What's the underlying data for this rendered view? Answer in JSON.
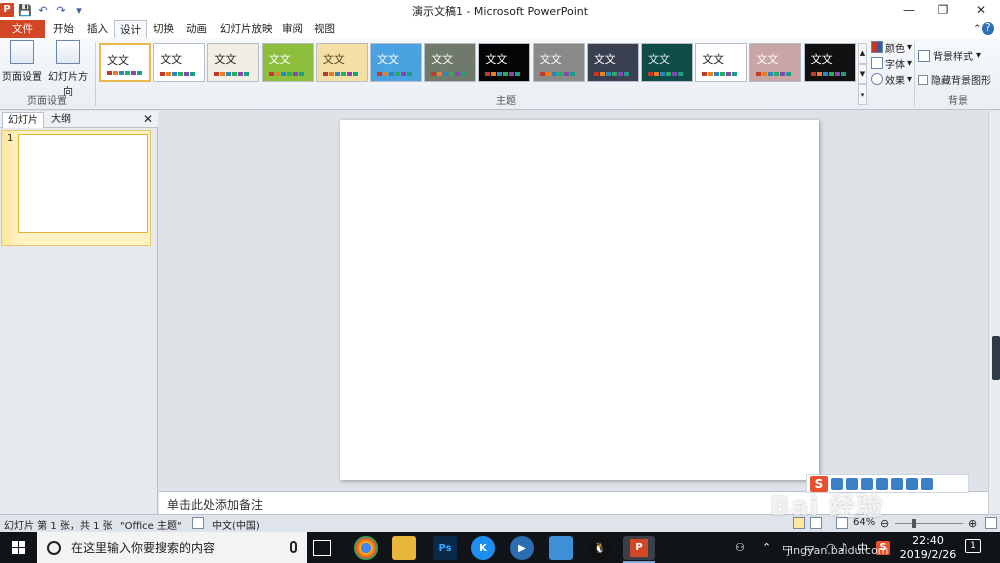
{
  "window": {
    "title": "演示文稿1 - Microsoft PowerPoint",
    "app_icon": "P",
    "minimize": "—",
    "restore": "❐",
    "close": "✕"
  },
  "qat": {
    "save": "💾",
    "undo": "↶",
    "redo": "↷",
    "customize": "▾"
  },
  "tabs": {
    "file": "文件",
    "home": "开始",
    "insert": "插入",
    "design": "设计",
    "transitions": "切换",
    "animations": "动画",
    "slideshow": "幻灯片放映",
    "review": "审阅",
    "view": "视图",
    "help": "?",
    "collapse": "⌃"
  },
  "ribbon": {
    "page_setup": {
      "page_setup_label": "页面设置",
      "orientation_label": "幻灯片方向",
      "group_label": "页面设置"
    },
    "themes": {
      "group_label": "主题",
      "sample_text": "文文",
      "items": [
        {
          "bg": "#ffffff",
          "fg": "#222222"
        },
        {
          "bg": "#ffffff",
          "fg": "#222222"
        },
        {
          "bg": "#f1eee3",
          "fg": "#222222"
        },
        {
          "bg": "#8dbf3d",
          "fg": "#ffffff"
        },
        {
          "bg": "#f4dfa6",
          "fg": "#5a4020"
        },
        {
          "bg": "#4aa3e0",
          "fg": "#ffffff"
        },
        {
          "bg": "#6f7a6a",
          "fg": "#ffffff"
        },
        {
          "bg": "#050505",
          "fg": "#ffffff"
        },
        {
          "bg": "#8a8a8a",
          "fg": "#ffffff"
        },
        {
          "bg": "#3b3f52",
          "fg": "#ffffff"
        },
        {
          "bg": "#0f4c47",
          "fg": "#e0f0ee"
        },
        {
          "bg": "#ffffff",
          "fg": "#222222"
        },
        {
          "bg": "#c9a6a6",
          "fg": "#ffffff"
        },
        {
          "bg": "#111111",
          "fg": "#ffffff"
        }
      ]
    },
    "theme_options": {
      "colors": "颜色",
      "fonts": "字体",
      "effects": "效果"
    },
    "background": {
      "styles": "背景样式",
      "hide_graphics": "隐藏背景图形",
      "group_label": "背景"
    }
  },
  "left_pane": {
    "tab_slides": "幻灯片",
    "tab_outline": "大纲",
    "close": "✕",
    "slide_number": "1"
  },
  "notes": {
    "placeholder": "单击此处添加备注"
  },
  "status": {
    "slide_info": "幻灯片 第 1 张，共 1 张",
    "theme": "\"Office 主题\"",
    "language": "中文(中国)",
    "zoom": "64%"
  },
  "taskbar": {
    "search_placeholder": "在这里输入你要搜索的内容",
    "time": "22:40",
    "date": "2019/2/26",
    "ime_lang": "中",
    "notifications": "1"
  },
  "watermark": {
    "text": "Bai 经验",
    "url": "jingyan.baidu.com"
  }
}
